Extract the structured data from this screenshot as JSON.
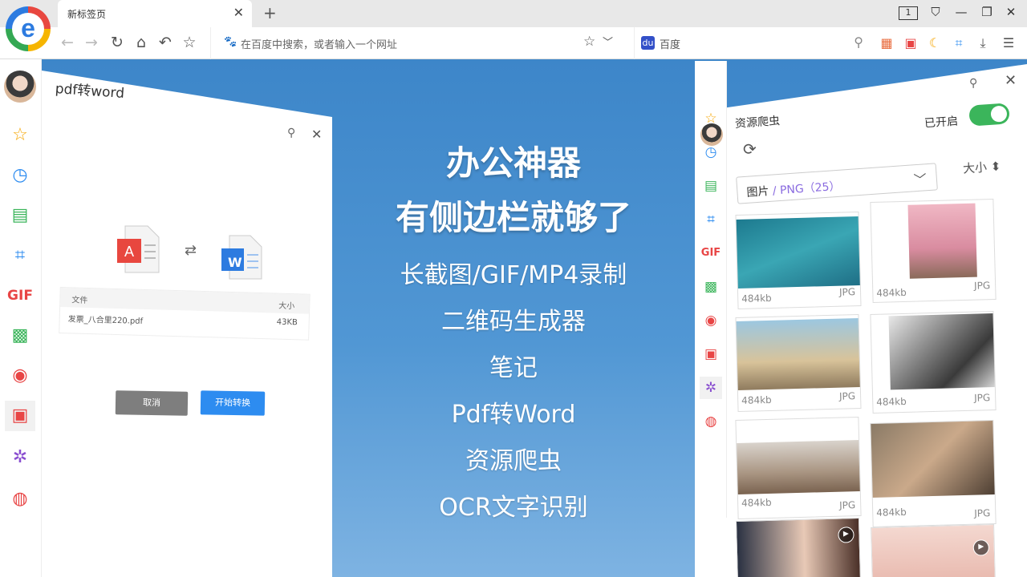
{
  "browser": {
    "tab_title": "新标签页",
    "tab_count": "1",
    "address_placeholder": "在百度中搜索，或者输入一个网址",
    "search_engine": "百度"
  },
  "left_panel": {
    "title": "pdf转word",
    "table_header_file": "文件",
    "table_header_size": "大小",
    "file_name": "发票_八合里220.pdf",
    "file_size": "43KB",
    "cancel_label": "取消",
    "start_label": "开始转换",
    "word_letter": "W"
  },
  "center": {
    "headline1": "办公神器",
    "headline2": "有侧边栏就够了",
    "features": [
      "长截图/GIF/MP4录制",
      "二维码生成器",
      "笔记",
      "Pdf转Word",
      "资源爬虫",
      "OCR文字识别"
    ]
  },
  "right_panel": {
    "title": "资源爬虫",
    "status": "已开启",
    "filter_label": "图片",
    "filter_value": "/ PNG（25）",
    "sort_label": "大小 ⬍",
    "thumbs": [
      {
        "size": "484kb",
        "type": "JPG"
      },
      {
        "size": "484kb",
        "type": "JPG"
      },
      {
        "size": "484kb",
        "type": "JPG"
      },
      {
        "size": "484kb",
        "type": "JPG"
      },
      {
        "size": "484kb",
        "type": "JPG"
      },
      {
        "size": "484kb",
        "type": "JPG"
      },
      {
        "size": "",
        "type": ""
      },
      {
        "size": "",
        "type": ""
      }
    ]
  },
  "sidebar_icons": [
    "star-icon",
    "clock-icon",
    "note-icon",
    "crop-icon",
    "gif-icon",
    "qrcode-icon",
    "record-icon",
    "pdf-icon",
    "bug-icon",
    "weibo-icon"
  ],
  "colors": {
    "accent": "#2d8cf0",
    "toggle": "#3bb55b",
    "background": "#3f87c9"
  }
}
